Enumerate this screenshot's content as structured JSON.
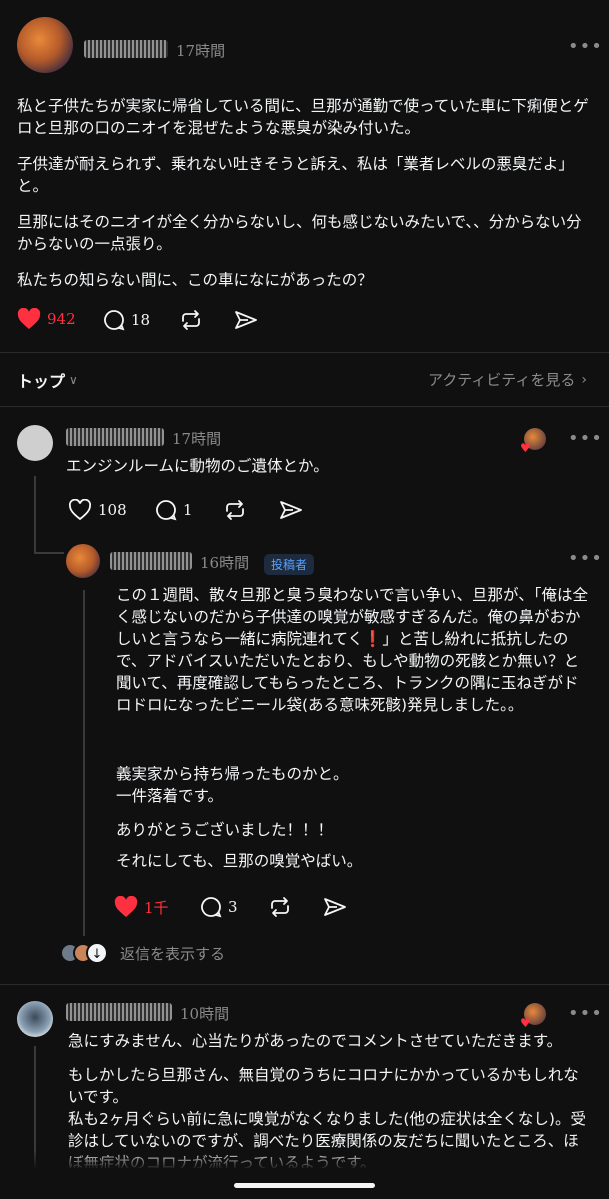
{
  "post": {
    "time": "17時間",
    "paragraphs": [
      "私と子供たちが実家に帰省している間に、旦那が通勤で使っていた車に下痢便とゲロと旦那の口のニオイを混ぜたような悪臭が染み付いた。",
      "子供達が耐えられず、乗れない吐きそうと訴え、私は「業者レベルの悪臭だよ」と。",
      "旦那にはそのニオイが全く分からないし、何も感じないみたいで、、分からない分からないの一点張り。",
      "私たちの知らない間に、この車になにがあったの？"
    ],
    "likes": "942",
    "replies": "18"
  },
  "sort": {
    "label": "トップ",
    "activity_link": "アクティビティを見る"
  },
  "comment1": {
    "time": "17時間",
    "text": "エンジンルームに動物のご遺体とか。",
    "likes": "108",
    "replies": "1"
  },
  "reply1": {
    "time": "16時間",
    "badge": "投稿者",
    "paragraphs": [
      "この１週間、散々旦那と臭う臭わないで言い争い、旦那が、「俺は全く感じないのだから子供達の嗅覚が敏感すぎるんだ。俺の鼻がおかしいと言うなら一緒に病院連れてく❗」と苦し紛れに抵抗したので、アドバイスいただいたとおり、もしや動物の死骸とか無い？と聞いて、再度確認してもらったところ、トランクの隅に玉ねぎがドロドロになったビニール袋(ある意味死骸)発見しました。。",
      "義実家から持ち帰ったものかと。\n一件落着です。",
      "ありがとうございました！！！",
      "それにしても、旦那の嗅覚やばい。"
    ],
    "likes": "1千",
    "replies": "3",
    "show_replies": "返信を表示する"
  },
  "comment2": {
    "time": "10時間",
    "paragraphs": [
      "急にすみません、心当たりがあったのでコメントさせていただきます。",
      "もしかしたら旦那さん、無自覚のうちにコロナにかかっているかもしれないです。\n私も2ヶ月ぐらい前に急に嗅覚がなくなりました(他の症状は全くなし)。受診はしていないのですが、調べたり医療関係の友だちに聞いたところ、ほぼ無症状のコロナが流行っているようです。"
    ]
  },
  "colors": {
    "like_red": "#ff3040",
    "background": "#101010",
    "badge_blue": "#5aa4ff"
  }
}
